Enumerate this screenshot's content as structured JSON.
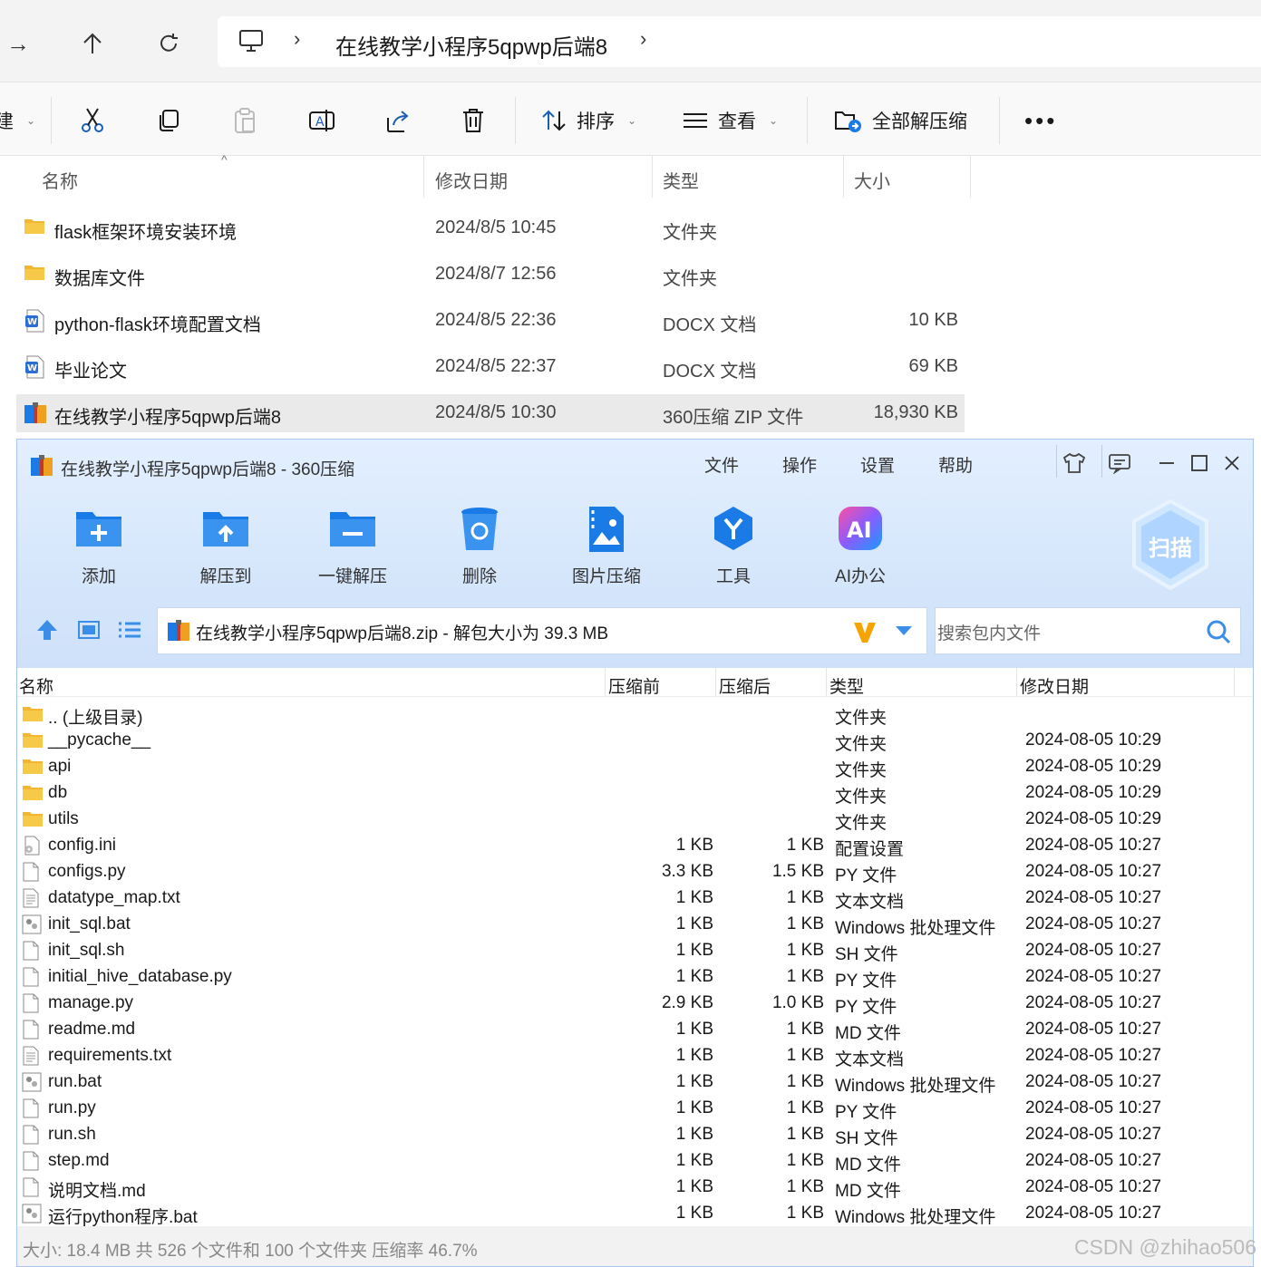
{
  "explorer": {
    "breadcrumb": "在线教学小程序5qpwp后端8",
    "toolbar": {
      "sort_label": "排序",
      "view_label": "查看",
      "extract_all_label": "全部解压缩"
    },
    "columns": {
      "name": "名称",
      "modified": "修改日期",
      "type": "类型",
      "size": "大小"
    },
    "rows": [
      {
        "name": "flask框架环境安装环境",
        "modified": "2024/8/5 10:45",
        "type": "文件夹",
        "size": "",
        "icon": "folder-icon"
      },
      {
        "name": "数据库文件",
        "modified": "2024/8/7 12:56",
        "type": "文件夹",
        "size": "",
        "icon": "folder-icon"
      },
      {
        "name": "python-flask环境配置文档",
        "modified": "2024/8/5 22:36",
        "type": "DOCX 文档",
        "size": "10 KB",
        "icon": "word-doc-icon"
      },
      {
        "name": "毕业论文",
        "modified": "2024/8/5 22:37",
        "type": "DOCX 文档",
        "size": "69 KB",
        "icon": "word-doc-icon"
      },
      {
        "name": "在线教学小程序5qpwp后端8",
        "modified": "2024/8/5 10:30",
        "type": "360压缩 ZIP 文件",
        "size": "18,930 KB",
        "icon": "zip-archive-icon",
        "selected": true
      }
    ]
  },
  "zip": {
    "title": "在线教学小程序5qpwp后端8 - 360压缩",
    "menu": [
      "文件",
      "操作",
      "设置",
      "帮助"
    ],
    "buttons": [
      {
        "label": "添加",
        "icon": "add-icon"
      },
      {
        "label": "解压到",
        "icon": "extract-to-icon"
      },
      {
        "label": "一键解压",
        "icon": "one-click-extract-icon"
      },
      {
        "label": "删除",
        "icon": "delete-icon"
      },
      {
        "label": "图片压缩",
        "icon": "image-compress-icon"
      },
      {
        "label": "工具",
        "icon": "tools-icon"
      },
      {
        "label": "AI办公",
        "icon": "ai-office-icon"
      }
    ],
    "scan_label": "扫描",
    "path": "在线教学小程序5qpwp后端8.zip - 解包大小为 39.3 MB",
    "search_placeholder": "搜索包内文件",
    "columns": {
      "name": "名称",
      "before": "压缩前",
      "after": "压缩后",
      "type": "类型",
      "modified": "修改日期"
    },
    "rows": [
      {
        "name": ".. (上级目录)",
        "before": "",
        "after": "",
        "type": "文件夹",
        "modified": "",
        "icon": "folder-icon"
      },
      {
        "name": "__pycache__",
        "before": "",
        "after": "",
        "type": "文件夹",
        "modified": "2024-08-05 10:29",
        "icon": "folder-icon"
      },
      {
        "name": "api",
        "before": "",
        "after": "",
        "type": "文件夹",
        "modified": "2024-08-05 10:29",
        "icon": "folder-icon"
      },
      {
        "name": "db",
        "before": "",
        "after": "",
        "type": "文件夹",
        "modified": "2024-08-05 10:29",
        "icon": "folder-icon"
      },
      {
        "name": "utils",
        "before": "",
        "after": "",
        "type": "文件夹",
        "modified": "2024-08-05 10:29",
        "icon": "folder-icon"
      },
      {
        "name": "config.ini",
        "before": "1 KB",
        "after": "1 KB",
        "type": "配置设置",
        "modified": "2024-08-05 10:27",
        "icon": "config-file-icon"
      },
      {
        "name": "configs.py",
        "before": "3.3 KB",
        "after": "1.5 KB",
        "type": "PY 文件",
        "modified": "2024-08-05 10:27",
        "icon": "file-icon"
      },
      {
        "name": "datatype_map.txt",
        "before": "1 KB",
        "after": "1 KB",
        "type": "文本文档",
        "modified": "2024-08-05 10:27",
        "icon": "text-file-icon"
      },
      {
        "name": "init_sql.bat",
        "before": "1 KB",
        "after": "1 KB",
        "type": "Windows 批处理文件",
        "modified": "2024-08-05 10:27",
        "icon": "batch-file-icon"
      },
      {
        "name": "init_sql.sh",
        "before": "1 KB",
        "after": "1 KB",
        "type": "SH 文件",
        "modified": "2024-08-05 10:27",
        "icon": "file-icon"
      },
      {
        "name": "initial_hive_database.py",
        "before": "1 KB",
        "after": "1 KB",
        "type": "PY 文件",
        "modified": "2024-08-05 10:27",
        "icon": "file-icon"
      },
      {
        "name": "manage.py",
        "before": "2.9 KB",
        "after": "1.0 KB",
        "type": "PY 文件",
        "modified": "2024-08-05 10:27",
        "icon": "file-icon"
      },
      {
        "name": "readme.md",
        "before": "1 KB",
        "after": "1 KB",
        "type": "MD 文件",
        "modified": "2024-08-05 10:27",
        "icon": "file-icon"
      },
      {
        "name": "requirements.txt",
        "before": "1 KB",
        "after": "1 KB",
        "type": "文本文档",
        "modified": "2024-08-05 10:27",
        "icon": "text-file-icon"
      },
      {
        "name": "run.bat",
        "before": "1 KB",
        "after": "1 KB",
        "type": "Windows 批处理文件",
        "modified": "2024-08-05 10:27",
        "icon": "batch-file-icon"
      },
      {
        "name": "run.py",
        "before": "1 KB",
        "after": "1 KB",
        "type": "PY 文件",
        "modified": "2024-08-05 10:27",
        "icon": "file-icon"
      },
      {
        "name": "run.sh",
        "before": "1 KB",
        "after": "1 KB",
        "type": "SH 文件",
        "modified": "2024-08-05 10:27",
        "icon": "file-icon"
      },
      {
        "name": "step.md",
        "before": "1 KB",
        "after": "1 KB",
        "type": "MD 文件",
        "modified": "2024-08-05 10:27",
        "icon": "file-icon"
      },
      {
        "name": "说明文档.md",
        "before": "1 KB",
        "after": "1 KB",
        "type": "MD 文件",
        "modified": "2024-08-05 10:27",
        "icon": "file-icon"
      },
      {
        "name": "运行python程序.bat",
        "before": "1 KB",
        "after": "1 KB",
        "type": "Windows 批处理文件",
        "modified": "2024-08-05 10:27",
        "icon": "batch-file-icon"
      }
    ],
    "status": "大小: 18.4 MB 共 526 个文件和 100 个文件夹 压缩率 46.7%",
    "watermark": "CSDN @zhihao506"
  },
  "colors": {
    "folder": "#f7c948",
    "word": "#2b6fd6",
    "zip_blue": "#1a7ae6",
    "zip_header": "#d5e6fb",
    "selection": "#eaeaea"
  }
}
